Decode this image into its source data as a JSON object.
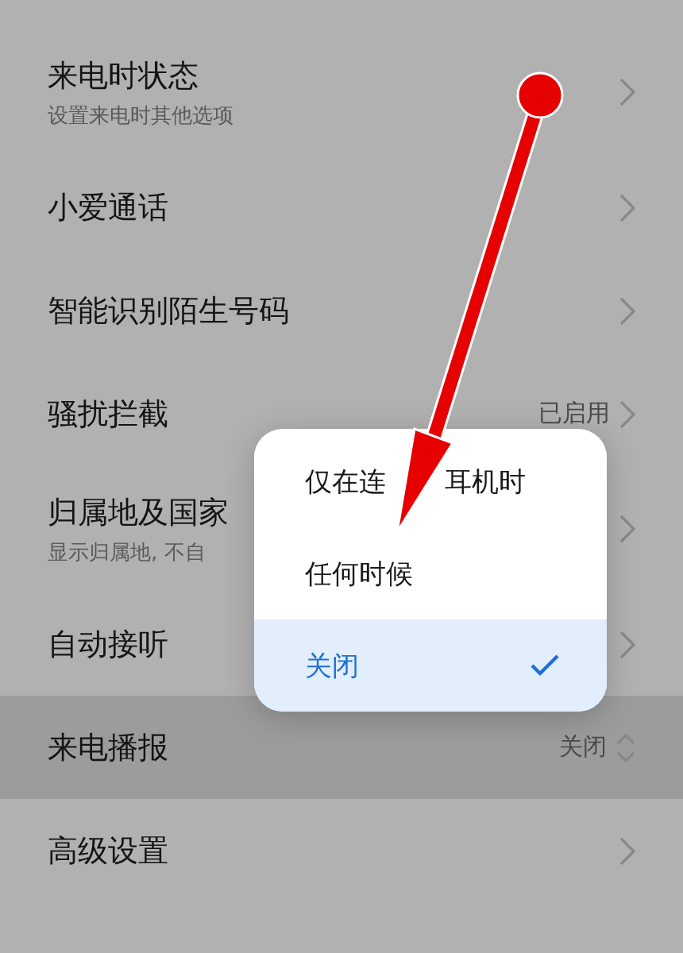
{
  "settings": [
    {
      "kind": "nav",
      "title": "来电时状态",
      "subtitle": "设置来电时其他选项",
      "highlighted": false
    },
    {
      "kind": "nav",
      "title": "小爱通话",
      "highlighted": false
    },
    {
      "kind": "nav",
      "title": "智能识别陌生号码",
      "highlighted": false
    },
    {
      "kind": "value",
      "title": "骚扰拦截",
      "value": "已启用",
      "highlighted": false
    },
    {
      "kind": "nav",
      "title": "归属地及国家",
      "subtitle": "显示归属地, 不自",
      "highlighted": false
    },
    {
      "kind": "nav",
      "title": "自动接听",
      "highlighted": false
    },
    {
      "kind": "picker",
      "title": "来电播报",
      "value": "关闭",
      "highlighted": true
    },
    {
      "kind": "nav",
      "title": "高级设置",
      "highlighted": false
    }
  ],
  "popup": {
    "options": [
      {
        "label_parts": [
          "仅在连",
          "耳机时"
        ],
        "selected": false
      },
      {
        "label": "任何时候",
        "selected": false
      },
      {
        "label": "关闭",
        "selected": true
      }
    ]
  },
  "annotation": {
    "kind": "arrow"
  }
}
